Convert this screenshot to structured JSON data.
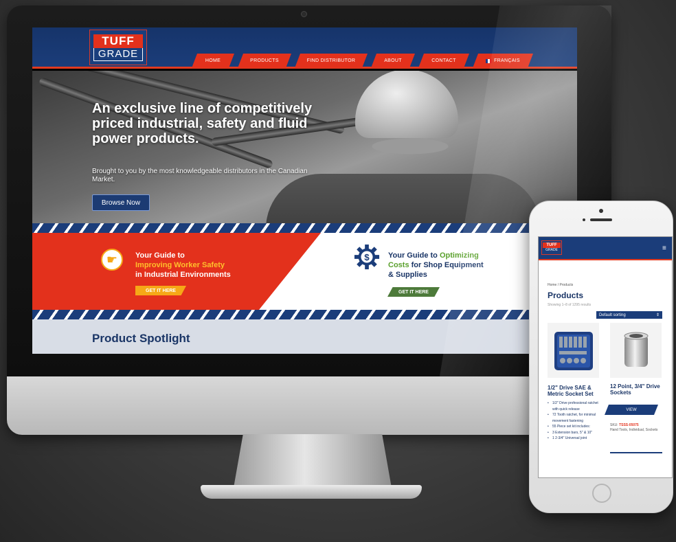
{
  "site": {
    "logo": {
      "line1": "TUFF",
      "line2": "GRADE"
    },
    "nav": [
      {
        "label": "HOME"
      },
      {
        "label": "PRODUCTS"
      },
      {
        "label": "FIND DISTRIBUTOR"
      },
      {
        "label": "ABOUT"
      },
      {
        "label": "CONTACT"
      },
      {
        "label": "FRANÇAIS"
      }
    ],
    "hero": {
      "title": "An exclusive line of competitively priced industrial, safety and fluid power products.",
      "subtitle": "Brought to you by the most knowledgeable distributors in the Canadian Market.",
      "button": "Browse Now"
    },
    "promo1": {
      "line1": "Your Guide to",
      "line2": "Improving Worker Safety",
      "line3": "in Industrial Environments",
      "button": "GET IT HERE"
    },
    "promo2": {
      "part1": "Your Guide to ",
      "part2": "Optimizing",
      "part3": "Costs",
      "part4": " for Shop Equipment",
      "part5": "& Supplies",
      "button": "GET IT HERE"
    },
    "spotlight_title": "Product Spotlight"
  },
  "mobile": {
    "logo": {
      "line1": "TUFF",
      "line2": "GRADE"
    },
    "breadcrumb": "Home / Products",
    "title": "Products",
    "showing": "Showing 1–8 of 1295 results",
    "sort": {
      "selected": "Default sorting"
    },
    "products": [
      {
        "title": "1/2\" Drive SAE & Metric Socket Set",
        "bullets": [
          "1/2\" Drive professional ratchet with quick release",
          "72 Tooth ratchet, for minimal movement fastening",
          "55 Piece set kit includes:",
          "3 Extension bars, 5\" & 10\"",
          "1 2-3/4\" Universal joint"
        ]
      },
      {
        "title": "12 Point, 3/4\" Drive Sockets",
        "button": "VIEW",
        "sku_label": "SKU: ",
        "sku_value": "TSSS-05075",
        "category": "Hand Tools, Individual, Sockets"
      }
    ]
  },
  "colors": {
    "brand_navy": "#1b3d7a",
    "brand_red": "#e3311c",
    "accent_yellow": "#f6a817",
    "accent_green": "#5aa02c"
  }
}
